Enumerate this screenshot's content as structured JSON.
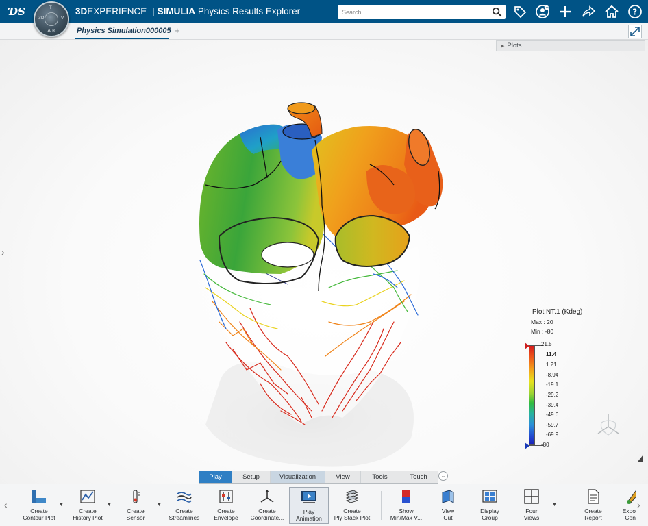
{
  "header": {
    "brand_bold": "3D",
    "brand_rest": "EXPERIENCE",
    "separator": "|",
    "product_bold": "SIMULIA",
    "app_name": "Physics Results Explorer",
    "search_placeholder": "Search",
    "icons": [
      "tag-icon",
      "user-add-icon",
      "plus-icon",
      "share-icon",
      "home-icon",
      "help-icon"
    ],
    "accent_color": "#005386"
  },
  "tabs": {
    "document_tab": "Physics Simulation000005",
    "add_tab": "+"
  },
  "viewport": {
    "plots_panel_label": "Plots",
    "legend": {
      "title": "Plot NT.1 (Kdeg)",
      "max_label": "Max : 20",
      "min_label": "Min : -80",
      "ticks": [
        "21.5",
        "11.4",
        "1.21",
        "-8.94",
        "-19.1",
        "-29.2",
        "-39.4",
        "-49.6",
        "-59.7",
        "-69.9",
        "-80"
      ]
    }
  },
  "section_tabs": {
    "items": [
      "Play",
      "Setup",
      "Visualization",
      "View",
      "Tools",
      "Touch"
    ],
    "active": "Play"
  },
  "action_bar": {
    "buttons": [
      {
        "line1": "Create",
        "line2": "Contour Plot",
        "icon": "contour-plot-icon"
      },
      {
        "line1": "Create",
        "line2": "History Plot",
        "icon": "history-plot-icon"
      },
      {
        "line1": "Create",
        "line2": "Sensor",
        "icon": "sensor-icon"
      },
      {
        "line1": "Create",
        "line2": "Streamlines",
        "icon": "streamlines-icon"
      },
      {
        "line1": "Create",
        "line2": "Envelope",
        "icon": "envelope-icon"
      },
      {
        "line1": "Create",
        "line2": "Coordinate...",
        "icon": "coordinate-system-icon"
      },
      {
        "line1": "Play",
        "line2": "Animation",
        "icon": "play-animation-icon"
      },
      {
        "line1": "Create",
        "line2": "Ply Stack Plot",
        "icon": "ply-stack-icon"
      },
      {
        "line1": "Show",
        "line2": "Min/Max V...",
        "icon": "min-max-icon"
      },
      {
        "line1": "View",
        "line2": "Cut",
        "icon": "view-cut-icon"
      },
      {
        "line1": "Display",
        "line2": "Group",
        "icon": "display-group-icon"
      },
      {
        "line1": "Four",
        "line2": "Views",
        "icon": "four-views-icon"
      },
      {
        "line1": "Create",
        "line2": "Report",
        "icon": "report-icon"
      },
      {
        "line1": "Expo",
        "line2": "Con",
        "icon": "export-icon"
      }
    ]
  }
}
